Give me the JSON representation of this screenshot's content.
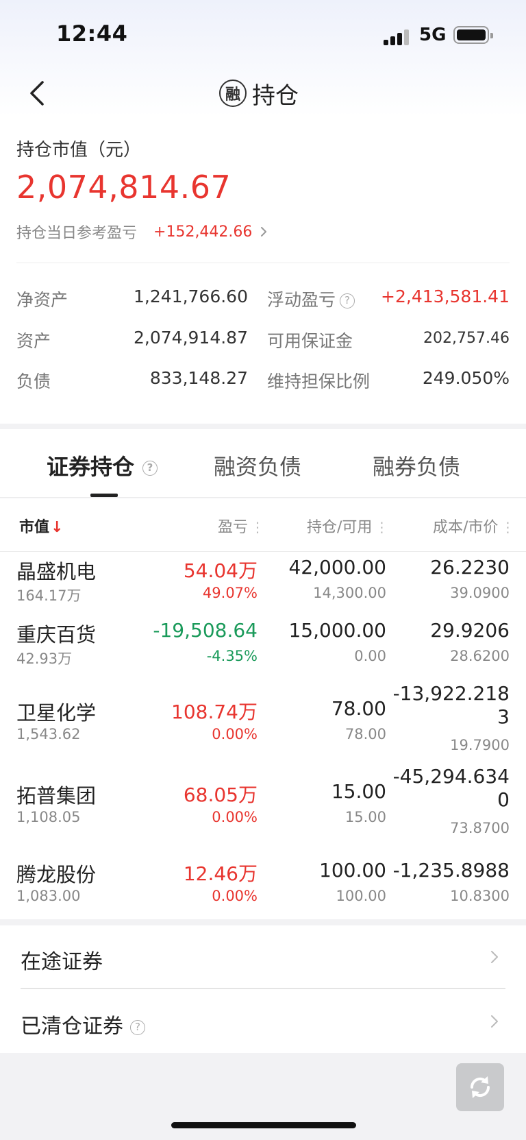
{
  "status_bar": {
    "time": "12:44",
    "network": "5G"
  },
  "nav": {
    "badge": "融",
    "title": "持仓"
  },
  "summary": {
    "market_value_label": "持仓市值（元）",
    "market_value": "2,074,814.67",
    "daily_pl_label": "持仓当日参考盈亏",
    "daily_pl_value": "+152,442.66"
  },
  "stats": {
    "net_assets_label": "净资产",
    "net_assets": "1,241,766.60",
    "floating_pl_label": "浮动盈亏",
    "floating_pl": "+2,413,581.41",
    "assets_label": "资产",
    "assets": "2,074,914.87",
    "margin_label": "可用保证金",
    "margin": "202,757.46",
    "liabilities_label": "负债",
    "liabilities": "833,148.27",
    "ratio_label": "维持担保比例",
    "ratio": "249.050%"
  },
  "tabs": [
    "证券持仓",
    "融资负债",
    "融券负债"
  ],
  "table": {
    "headers": {
      "market_value": "市值",
      "sort_arrow": "↓",
      "pl": "盈亏",
      "position": "持仓/可用",
      "cost": "成本/市价"
    },
    "rows": [
      {
        "name": "晶盛机电",
        "mv": "164.17万",
        "pl": "54.04万",
        "pl_pct": "49.07%",
        "pl_color": "red",
        "position": "42,000.00",
        "available": "14,300.00",
        "cost_l1": "26.2230",
        "cost_l2": "",
        "price": "39.0900"
      },
      {
        "name": "重庆百货",
        "mv": "42.93万",
        "pl": "-19,508.64",
        "pl_pct": "-4.35%",
        "pl_color": "green",
        "position": "15,000.00",
        "available": "0.00",
        "cost_l1": "29.9206",
        "cost_l2": "",
        "price": "28.6200"
      },
      {
        "name": "卫星化学",
        "mv": "1,543.62",
        "pl": "108.74万",
        "pl_pct": "0.00%",
        "pl_color": "red",
        "position": "78.00",
        "available": "78.00",
        "cost_l1": "-13,922.218",
        "cost_l2": "3",
        "price": "19.7900"
      },
      {
        "name": "拓普集团",
        "mv": "1,108.05",
        "pl": "68.05万",
        "pl_pct": "0.00%",
        "pl_color": "red",
        "position": "15.00",
        "available": "15.00",
        "cost_l1": "-45,294.634",
        "cost_l2": "0",
        "price": "73.8700"
      },
      {
        "name": "腾龙股份",
        "mv": "1,083.00",
        "pl": "12.46万",
        "pl_pct": "0.00%",
        "pl_color": "red",
        "position": "100.00",
        "available": "100.00",
        "cost_l1": "-1,235.8988",
        "cost_l2": "",
        "price": "10.8300"
      }
    ]
  },
  "links": {
    "in_transit": "在途证券",
    "cleared": "已清仓证券"
  },
  "icons": {
    "back": "back-chevron-icon",
    "help": "question-icon",
    "chevron": "chevron-right-icon",
    "refresh": "refresh-icon"
  },
  "colors": {
    "red": "#e8352f",
    "green": "#1a9a5a"
  }
}
